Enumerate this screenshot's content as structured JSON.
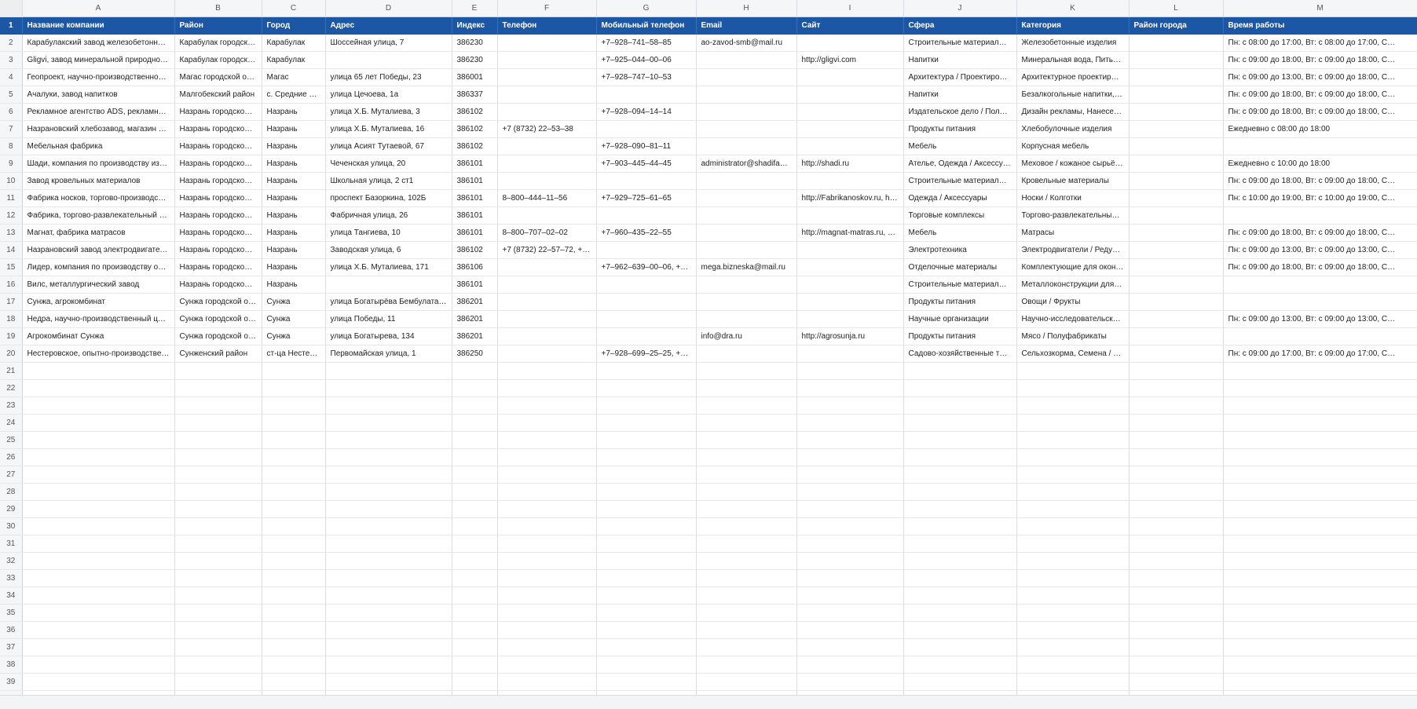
{
  "columns": [
    "A",
    "B",
    "C",
    "D",
    "E",
    "F",
    "G",
    "H",
    "I",
    "J",
    "K",
    "L",
    "M"
  ],
  "headers": [
    "Название компании",
    "Район",
    "Город",
    "Адрес",
    "Индекс",
    "Телефон",
    "Мобильный телефон",
    "Email",
    "Сайт",
    "Сфера",
    "Категория",
    "Район города",
    "Время работы"
  ],
  "rows": [
    [
      "Карабулакский завод железобетонны…",
      "Карабулак городской …",
      "Карабулак",
      "Шоссейная улица, 7",
      "386230",
      "",
      "+7‒928‒741‒58‒85",
      "ao-zavod-smb@mail.ru",
      "",
      "Строительные материалы …",
      "Железобетонные изделия",
      "",
      "Пн: с 08:00 до 17:00, Вт: с 08:00 до 17:00, С…"
    ],
    [
      "Gligvi, завод минеральной природно…",
      "Карабулак городской …",
      "Карабулак",
      "",
      "386230",
      "",
      "+7‒925‒044‒00‒06",
      "",
      "http://gligvi.com",
      "Напитки",
      "Минеральная вода, Питье…",
      "",
      "Пн: с 09:00 до 18:00, Вт: с 09:00 до 18:00, С…"
    ],
    [
      "Геопроект, научно-производственно…",
      "Магас городской округ",
      "Магас",
      "улица 65 лет Победы, 23",
      "386001",
      "",
      "+7‒928‒747‒10‒53",
      "",
      "",
      "Архитектура / Проектиров…",
      "Архитектурное проектир…",
      "",
      "Пн: с 09:00 до 13:00, Вт: с 09:00 до 18:00, С…"
    ],
    [
      "Ачалуки, завод напитков",
      "Малгобекский район",
      "с. Средние Ача…",
      "улица Цечоева, 1а",
      "386337",
      "",
      "",
      "",
      "",
      "Напитки",
      "Безалкогольные напитки, …",
      "",
      "Пн: с 09:00 до 18:00, Вт: с 09:00 до 18:00, С…"
    ],
    [
      "Рекламное агентство ADS, рекламно-…",
      "Назрань городской ок…",
      "Назрань",
      "улица Х.Б. Муталиева, 3",
      "386102",
      "",
      "+7‒928‒094‒14‒14",
      "",
      "",
      "Издательское дело / Поли…",
      "Дизайн рекламы, Нанесен…",
      "",
      "Пн: с 09:00 до 18:00, Вт: с 09:00 до 18:00, С…"
    ],
    [
      "Назрановский хлебозавод, магазин х…",
      "Назрань городской ок…",
      "Назрань",
      "улица Х.Б. Муталиева, 16",
      "386102",
      "+7 (8732) 22‒53‒38",
      "",
      "",
      "",
      "Продукты питания",
      "Хлебобулочные изделия",
      "",
      "Ежедневно с 08:00 до 18:00"
    ],
    [
      "Мебельная фабрика",
      "Назрань городской ок…",
      "Назрань",
      "улица Асият Тутаевой, 67",
      "386102",
      "",
      "+7‒928‒090‒81‒11",
      "",
      "",
      "Мебель",
      "Корпусная мебель",
      "",
      ""
    ],
    [
      "Шади, компания по производству из…",
      "Назрань городской ок…",
      "Назрань",
      "Чеченская улица, 20",
      "386101",
      "",
      "+7‒903‒445‒44‒45",
      "administrator@shadifa…",
      "http://shadi.ru",
      "Ателье, Одежда / Аксессуа…",
      "Меховое / кожаное сырьё,…",
      "",
      "Ежедневно с 10:00 до 18:00"
    ],
    [
      "Завод кровельных материалов",
      "Назрань городской ок…",
      "Назрань",
      "Школьная улица, 2 ст1",
      "386101",
      "",
      "",
      "",
      "",
      "Строительные материалы …",
      "Кровельные материалы",
      "",
      "Пн: с 09:00 до 18:00, Вт: с 09:00 до 18:00, С…"
    ],
    [
      "Фабрика носков, торгово-производст…",
      "Назрань городской ок…",
      "Назрань",
      "проспект Базоркина, 102Б",
      "386101",
      "8‒800‒444‒11‒56",
      "+7‒929‒725‒61‒65",
      "",
      "http://Fabrikanoskov.ru, h…",
      "Одежда / Аксессуары",
      "Носки / Колготки",
      "",
      "Пн: с 10:00 до 19:00, Вт: с 10:00 до 19:00, С…"
    ],
    [
      "Фабрика, торгово-развлекательный к…",
      "Назрань городской ок…",
      "Назрань",
      "Фабричная улица, 26",
      "386101",
      "",
      "",
      "",
      "",
      "Торговые комплексы",
      "Торгово-развлекательные …",
      "",
      ""
    ],
    [
      "Магнат, фабрика матрасов",
      "Назрань городской ок…",
      "Назрань",
      "улица Тангиева, 10",
      "386101",
      "8‒800‒707‒02‒02",
      "+7‒960‒435‒22‒55",
      "",
      "http://magnat-matras.ru, …",
      "Мебель",
      "Матрасы",
      "",
      "Пн: с 09:00 до 18:00, Вт: с 09:00 до 18:00, С…"
    ],
    [
      "Назрановский завод электродвигател…",
      "Назрань городской ок…",
      "Назрань",
      "Заводская улица, 6",
      "386102",
      "+7 (8732) 22‒57‒72, +7…",
      "",
      "",
      "",
      "Электротехника",
      "Электродвигатели / Редукт…",
      "",
      "Пн: с 09:00 до 13:00, Вт: с 09:00 до 13:00, С…"
    ],
    [
      "Лидер, компания по производству ок…",
      "Назрань городской ок…",
      "Назрань",
      "улица Х.Б. Муталиева, 171",
      "386106",
      "",
      "+7‒962‒639‒00‒06, +7…",
      "mega.bizneska@mail.ru",
      "",
      "Отделочные материалы",
      "Комплектующие для окон,…",
      "",
      "Пн: с 09:00 до 18:00, Вт: с 09:00 до 18:00, С…"
    ],
    [
      "Вилс, металлургический завод",
      "Назрань городской ок…",
      "Назрань",
      "",
      "386101",
      "",
      "",
      "",
      "",
      "Строительные материалы …",
      "Металлоконструкции для …",
      "",
      ""
    ],
    [
      "Сунжа, агрокомбинат",
      "Сунжа городской округ",
      "Сунжа",
      "улица Богатырёва Бембулата …",
      "386201",
      "",
      "",
      "",
      "",
      "Продукты питания",
      "Овощи / Фрукты",
      "",
      ""
    ],
    [
      "Недра, научно-производственный це…",
      "Сунжа городской округ",
      "Сунжа",
      "улица Победы, 11",
      "386201",
      "",
      "",
      "",
      "",
      "Научные организации",
      "Научно-исследовательски…",
      "",
      "Пн: с 09:00 до 13:00, Вт: с 09:00 до 13:00, С…"
    ],
    [
      "Агрокомбинат Сунжа",
      "Сунжа городской округ",
      "Сунжа",
      "улица Богатырева, 134",
      "386201",
      "",
      "",
      "info@dra.ru",
      "http://agrosunja.ru",
      "Продукты питания",
      "Мясо / Полуфабрикаты",
      "",
      ""
    ],
    [
      "Нестеровское, опытно-производстве…",
      "Сунженский район",
      "ст-ца Нестеров…",
      "Первомайская улица, 1",
      "386250",
      "",
      "+7‒928‒699‒25‒25, +7…",
      "",
      "",
      "Садово-хозяйственные то…",
      "Сельхозкорма, Семена / П…",
      "",
      "Пн: с 09:00 до 17:00, Вт: с 09:00 до 17:00, С…"
    ]
  ],
  "last_row_number": 41
}
